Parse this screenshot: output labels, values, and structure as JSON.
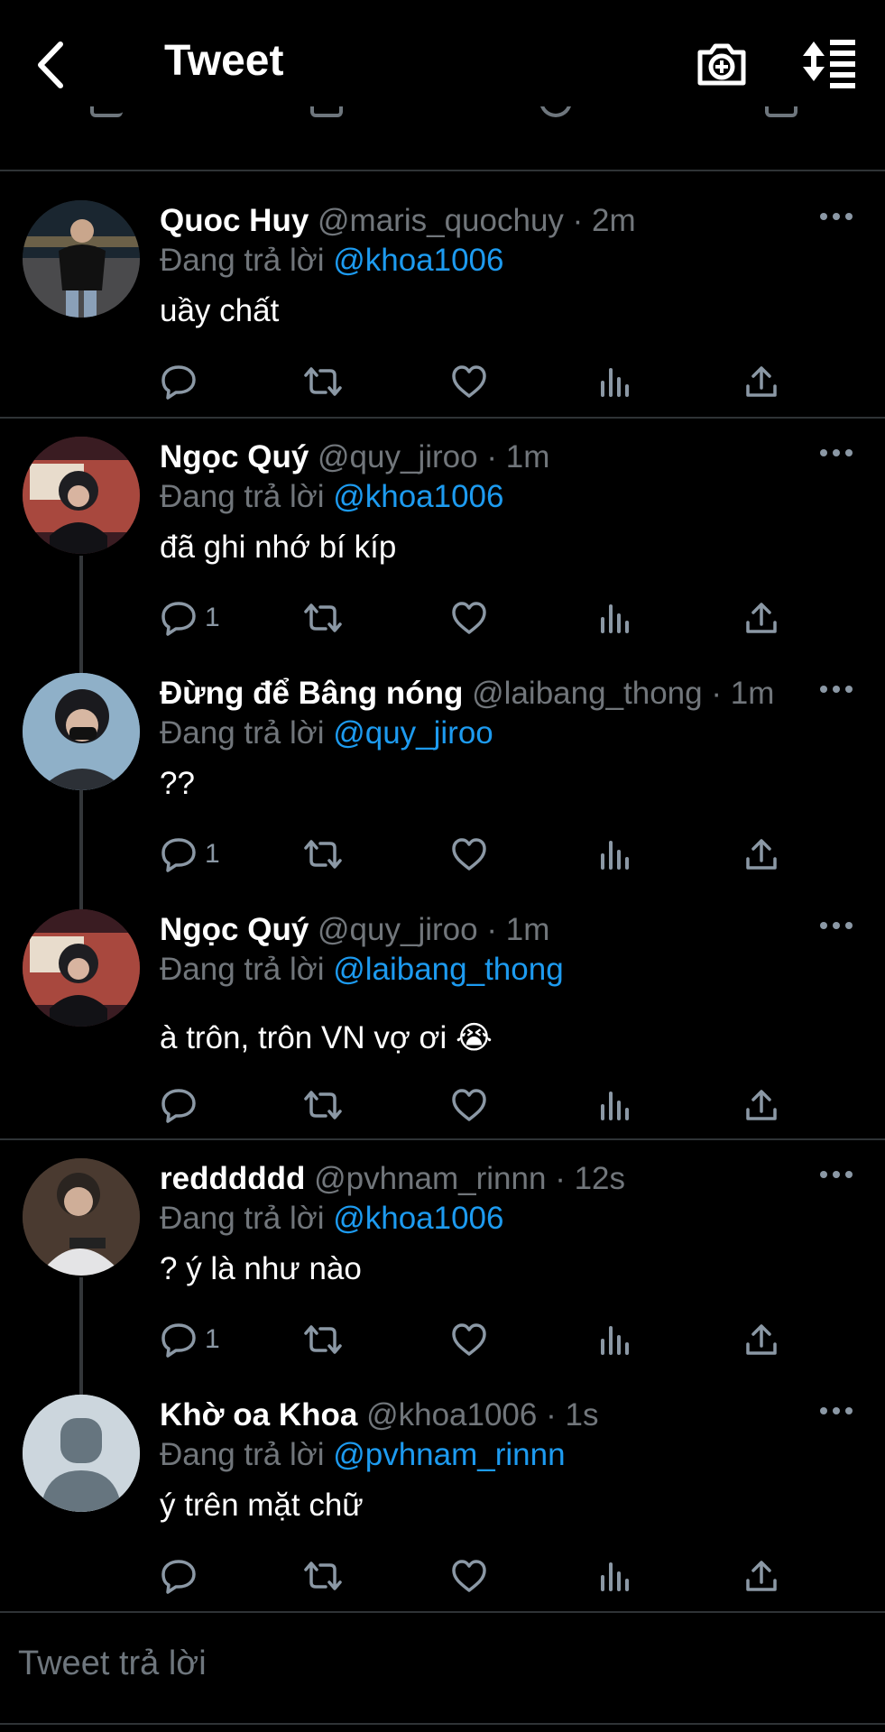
{
  "header": {
    "title": "Tweet"
  },
  "reply_prefix": "Đang trả lời",
  "tweets": [
    {
      "name": "Quoc Huy",
      "handle": "@maris_quochuy",
      "time": "2m",
      "reply_to": "@khoa1006",
      "text": "uầy chất",
      "reply_count": ""
    },
    {
      "name": "Ngọc Quý",
      "handle": "@quy_jiroo",
      "time": "1m",
      "reply_to": "@khoa1006",
      "text": "đã ghi nhớ bí kíp",
      "reply_count": "1"
    },
    {
      "name": "Đừng để Bâng nóng",
      "handle": "@laibang_thong",
      "time": "1m",
      "reply_to": "@quy_jiroo",
      "text": "??",
      "reply_count": "1"
    },
    {
      "name": "Ngọc Quý",
      "handle": "@quy_jiroo",
      "time": "1m",
      "reply_to": "@laibang_thong",
      "text": "à trôn, trôn VN vợ ơi  😭",
      "reply_count": ""
    },
    {
      "name": "redddddd",
      "handle": "@pvhnam_rinnn",
      "time": "12s",
      "reply_to": "@khoa1006",
      "text": "? ý là như nào",
      "reply_count": "1"
    },
    {
      "name": "Khờ oa Khoa",
      "handle": "@khoa1006",
      "time": "1s",
      "reply_to": "@pvhnam_rinnn",
      "text": "ý trên mặt chữ",
      "reply_count": ""
    }
  ],
  "composer": {
    "placeholder": "Tweet trả lời"
  },
  "colors": {
    "background": "#000000",
    "accent": "#1d9bf0",
    "muted": "#71767b",
    "divider": "#2f3336"
  },
  "icons": [
    "back-chevron-icon",
    "add-photo-camera-icon",
    "sort-replies-icon",
    "reply-icon",
    "retweet-icon",
    "like-icon",
    "analytics-icon",
    "share-icon",
    "more-icon"
  ]
}
